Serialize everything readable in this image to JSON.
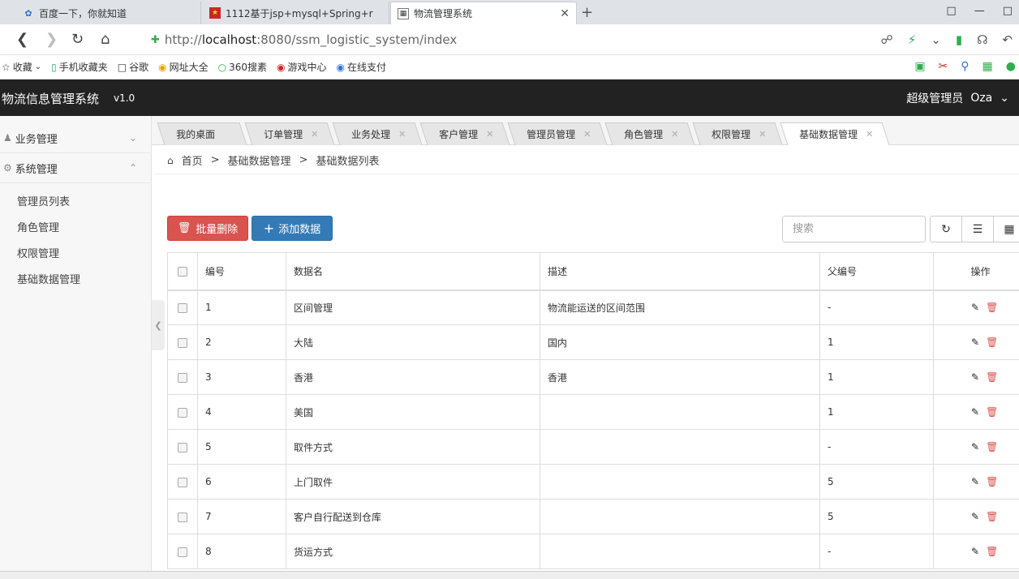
{
  "browser": {
    "tabs": [
      {
        "title": "百度一下，你就知道",
        "icon": "paw-icon"
      },
      {
        "title": "1112基于jsp+mysql+Spring+r",
        "icon": "red-square-icon"
      },
      {
        "title": "物流管理系统",
        "icon": "page-icon"
      }
    ],
    "url_prefix": "http://",
    "url_host": "localhost",
    "url_rest": ":8080/ssm_logistic_system/index",
    "bookmarks": [
      "收藏",
      "手机收藏夹",
      "谷歌",
      "网址大全",
      "360搜素",
      "游戏中心",
      "在线支付"
    ]
  },
  "app": {
    "title": "物流信息管理系统",
    "version": "v1.0",
    "user_role": "超级管理员",
    "user_name": "Oza"
  },
  "sidebar": {
    "groups": [
      {
        "label": "业务管理"
      },
      {
        "label": "系统管理"
      }
    ],
    "items": [
      {
        "label": "管理员列表"
      },
      {
        "label": "角色管理"
      },
      {
        "label": "权限管理"
      },
      {
        "label": "基础数据管理"
      }
    ]
  },
  "content_tabs": [
    {
      "label": "我的桌面"
    },
    {
      "label": "订单管理"
    },
    {
      "label": "业务处理"
    },
    {
      "label": "客户管理"
    },
    {
      "label": "管理员管理"
    },
    {
      "label": "角色管理"
    },
    {
      "label": "权限管理"
    },
    {
      "label": "基础数据管理"
    }
  ],
  "breadcrumb": {
    "items": [
      "首页",
      "基础数据管理",
      "基础数据列表"
    ],
    "separator": ">"
  },
  "toolbar": {
    "delete_label": "批量删除",
    "add_label": "添加数据",
    "search_placeholder": "搜索"
  },
  "table": {
    "headers": [
      "编号",
      "数据名",
      "描述",
      "父编号",
      "操作"
    ],
    "rows": [
      {
        "id": "1",
        "name": "区间管理",
        "desc": "物流能运送的区间范围",
        "parent": "-"
      },
      {
        "id": "2",
        "name": "大陆",
        "desc": "国内",
        "parent": "1"
      },
      {
        "id": "3",
        "name": "香港",
        "desc": "香港",
        "parent": "1"
      },
      {
        "id": "4",
        "name": "美国",
        "desc": "",
        "parent": "1"
      },
      {
        "id": "5",
        "name": "取件方式",
        "desc": "",
        "parent": "-"
      },
      {
        "id": "6",
        "name": "上门取件",
        "desc": "",
        "parent": "5"
      },
      {
        "id": "7",
        "name": "客户自行配送到仓库",
        "desc": "",
        "parent": "5"
      },
      {
        "id": "8",
        "name": "货运方式",
        "desc": "",
        "parent": "-"
      }
    ]
  },
  "colors": {
    "header_bg": "#222222",
    "danger": "#d9534f",
    "primary": "#337ab7"
  }
}
